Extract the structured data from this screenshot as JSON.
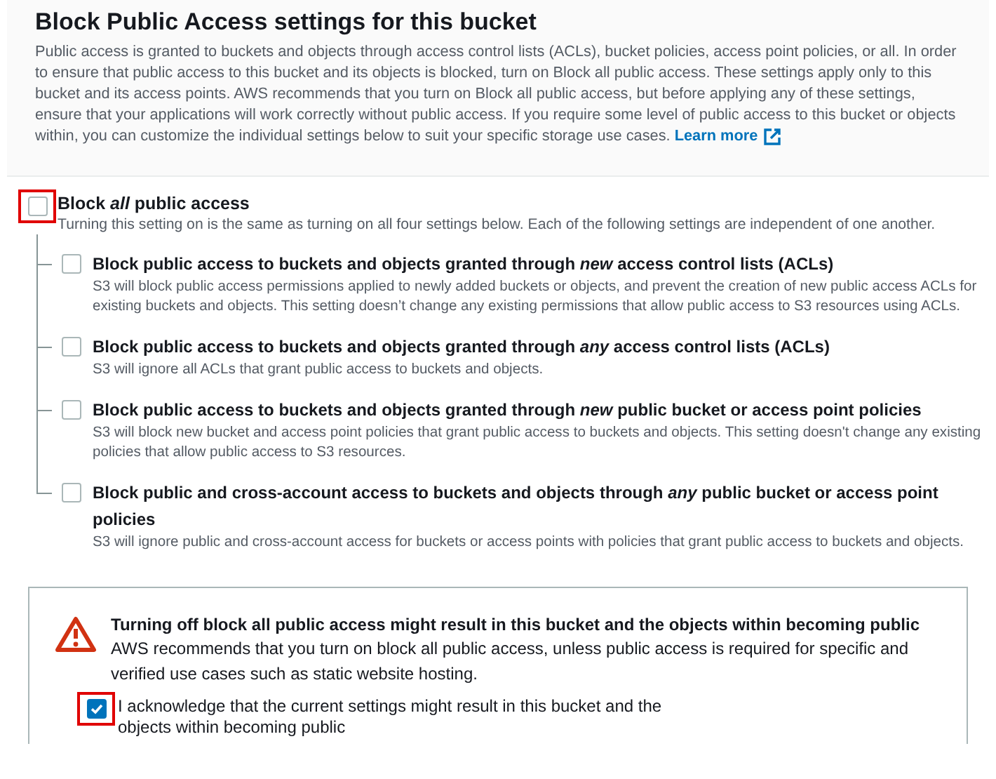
{
  "header": {
    "title": "Block Public Access settings for this bucket",
    "description": "Public access is granted to buckets and objects through access control lists (ACLs), bucket policies, access point policies, or all. In order to ensure that public access to this bucket and its objects is blocked, turn on Block all public access. These settings apply only to this bucket and its access points. AWS recommends that you turn on Block all public access, but before applying any of these settings, ensure that your applications will work correctly without public access. If you require some level of public access to this bucket or objects within, you can customize the individual settings below to suit your specific storage use cases.",
    "link": "Learn more"
  },
  "block_all": {
    "label": "Block *all* public access",
    "description": "Turning this setting on is the same as turning on all four settings below. Each of the following settings are independent of one another.",
    "checked": false,
    "highlighted": true,
    "children": [
      {
        "label": "Block public access to buckets and objects granted through *new* access control lists (ACLs)",
        "description": "S3 will block public access permissions applied to newly added buckets or objects, and prevent the creation of new public access ACLs for existing buckets and objects. This setting doesn’t change any existing permissions that allow public access to S3 resources using ACLs.",
        "checked": false,
        "highlighted": false
      },
      {
        "label": "Block public access to buckets and objects granted through *any* access control lists (ACLs)",
        "description": "S3 will ignore all ACLs that grant public access to buckets and objects.",
        "checked": false,
        "highlighted": false
      },
      {
        "label": "Block public access to buckets and objects granted through *new* public bucket or access point policies",
        "description": "S3 will block new bucket and access point policies that grant public access to buckets and objects. This setting doesn't change any existing policies that allow public access to S3 resources.",
        "checked": false,
        "highlighted": false
      },
      {
        "label": "Block public and cross-account access to buckets and objects through *any* public bucket or access point policies",
        "description": "S3 will ignore public and cross-account access for buckets or access points with policies that grant public access to buckets and objects.",
        "checked": false,
        "highlighted": false
      }
    ]
  },
  "warning": {
    "title": "Turning off block all public access might result in this bucket and the objects within becoming public",
    "description": "AWS recommends that you turn on block all public access, unless public access is required for specific and verified use cases such as static website hosting.",
    "acknowledge": {
      "label": "I acknowledge that the current settings might result in this bucket and the objects within becoming public",
      "checked": true,
      "highlighted": true
    }
  }
}
